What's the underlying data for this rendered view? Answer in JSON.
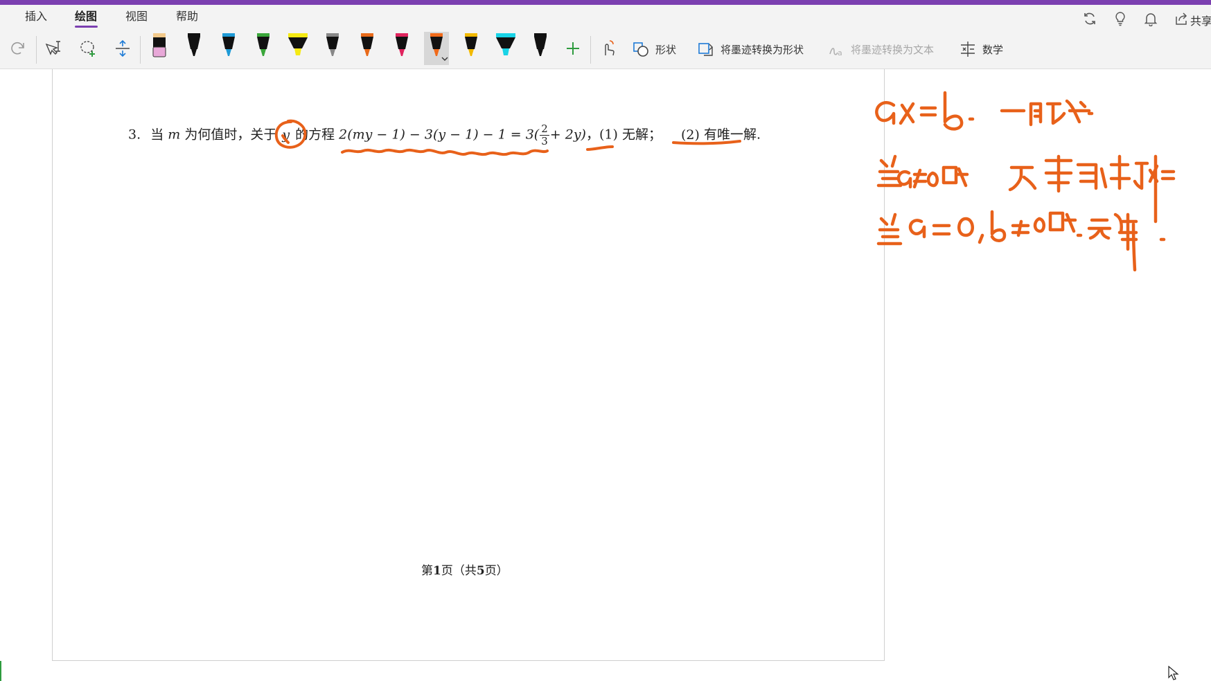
{
  "window": {
    "accent_color": "#7b3fb0"
  },
  "tabs": [
    {
      "label": "插入",
      "active": false
    },
    {
      "label": "绘图",
      "active": true
    },
    {
      "label": "视图",
      "active": false
    },
    {
      "label": "帮助",
      "active": false
    }
  ],
  "top_right": {
    "icons": [
      "sync-icon",
      "lightbulb-icon",
      "bell-icon",
      "share-icon"
    ],
    "share_label": "共享"
  },
  "toolbar": {
    "tools": [
      "redo-icon",
      "text-select-icon",
      "lasso-select-icon",
      "insert-space-icon"
    ],
    "pens": [
      {
        "name": "highlighter-pink",
        "color": "#e8a8d8"
      },
      {
        "name": "pen-black",
        "color": "#111111"
      },
      {
        "name": "pen-blue",
        "color": "#1e9ad6"
      },
      {
        "name": "pen-green",
        "color": "#3aa63a"
      },
      {
        "name": "highlighter-yellow",
        "color": "#f5ea14"
      },
      {
        "name": "pen-gray-pattern",
        "color": "#888888"
      },
      {
        "name": "pen-orange",
        "color": "#e86a1a"
      },
      {
        "name": "pen-red",
        "color": "#e0245e"
      },
      {
        "name": "pen-orange-selected",
        "color": "#f06a1a",
        "selected": true
      },
      {
        "name": "pencil-yellow",
        "color": "#f2b900"
      },
      {
        "name": "highlighter-cyan",
        "color": "#19d3e6"
      },
      {
        "name": "pen-black-2",
        "color": "#111111"
      }
    ],
    "add_pen_icon": "plus-icon",
    "touch_draw_icon": "touch-draw-icon",
    "shapes_label": "形状",
    "ink_to_shape_label": "将墨迹转换为形状",
    "ink_to_text_label": "将墨迹转换为文本",
    "math_label": "数学"
  },
  "document": {
    "problem_number": "3.",
    "problem_text_1": "当",
    "var_m": "m",
    "problem_text_2": "为何值时，关于",
    "var_y": "y",
    "problem_text_3": "的方程",
    "equation_left": "2(my − 1) − 3(y − 1) − 1 = 3(",
    "frac_num": "2",
    "frac_den": "3",
    "equation_right": "+ 2y)",
    "part1_prefix": "，(1)",
    "part1": "无解",
    "part1_suffix": "；",
    "part2_prefix": "(2)",
    "part2": "有唯一解",
    "part2_suffix": ".",
    "footer_1": "第",
    "footer_page": "1",
    "footer_2": "页（共",
    "footer_total": "5",
    "footer_3": "页）"
  },
  "ink_color": "#e8611a"
}
